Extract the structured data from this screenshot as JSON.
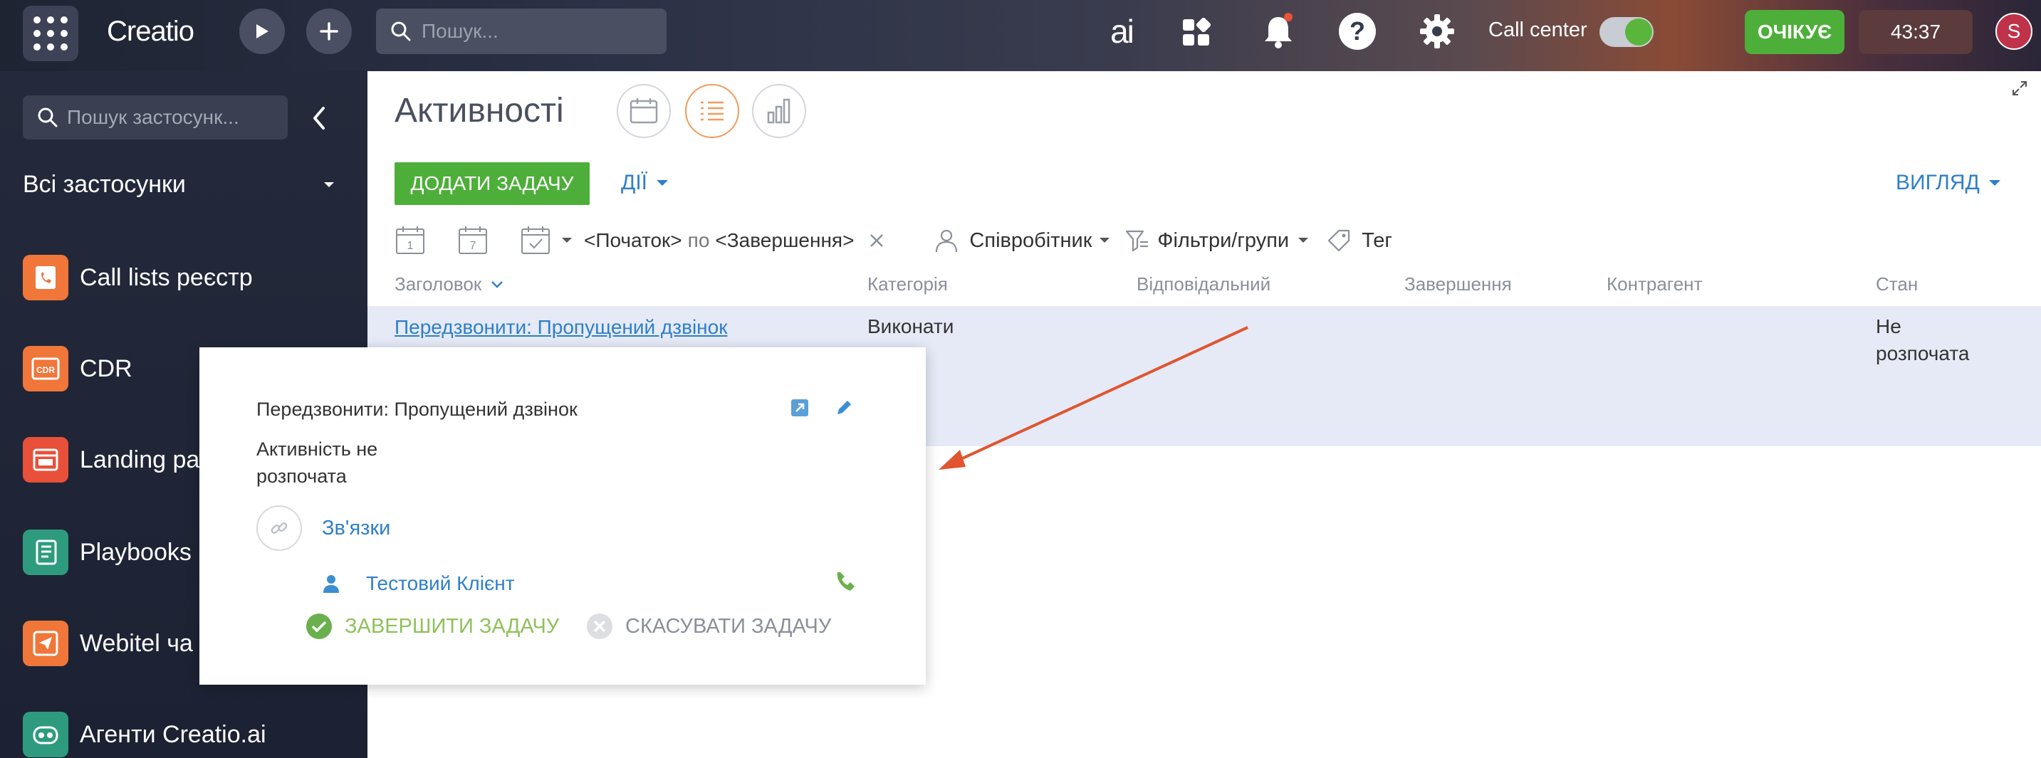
{
  "topbar": {
    "logo": "Creatio",
    "search_placeholder": "Пошук...",
    "ai_label": "ai",
    "call_center_label": "Call center",
    "status_label": "ОЧІКУЄ",
    "timer": "43:37",
    "avatar_initial": "S"
  },
  "sidebar": {
    "search_placeholder": "Пошук застосунк...",
    "section_label": "Всі застосунки",
    "items": [
      {
        "label": "Call lists реєстр",
        "color": "#f0763a"
      },
      {
        "label": "CDR",
        "color": "#f0763a"
      },
      {
        "label": "Landing pa",
        "color": "#e8503a"
      },
      {
        "label": "Playbooks",
        "color": "#2e9b7e"
      },
      {
        "label": "Webitel ча",
        "color": "#f0763a"
      },
      {
        "label": "Агенти Creatio.ai",
        "color": "#2e9b7e"
      }
    ]
  },
  "main": {
    "title": "Активності",
    "add_task_label": "ДОДАТИ ЗАДАЧУ",
    "actions_label": "ДІЇ",
    "view_label": "ВИГЛЯД",
    "filter": {
      "date_icon_1_day": "1",
      "date_icon_2_day": "7",
      "start": "<Початок>",
      "by": "по",
      "end": "<Завершення>",
      "employee": "Співробітник",
      "filters_groups": "Фільтри/групи",
      "tag": "Тег"
    },
    "columns": {
      "title": "Заголовок",
      "category": "Категорія",
      "owner": "Відповідальний",
      "due": "Завершення",
      "account": "Контрагент",
      "status": "Стан"
    },
    "row": {
      "title": "Передзвонити: Пропущений дзвінок",
      "category": "Виконати",
      "status_line1": "Не",
      "status_line2": "розпочата"
    }
  },
  "popup": {
    "title": "Передзвонити: Пропущений дзвінок",
    "status_line1": "Активність не",
    "status_line2": "розпочата",
    "links_label": "Зв'язки",
    "contact_name": "Тестовий Клієнт",
    "complete_label": "ЗАВЕРШИТИ ЗАДАЧУ",
    "cancel_label": "СКАСУВАТИ ЗАДАЧУ"
  },
  "colors": {
    "accent_green": "#4daf39",
    "link_blue": "#2f7fc9",
    "annotation_arrow": "#e0552f"
  }
}
